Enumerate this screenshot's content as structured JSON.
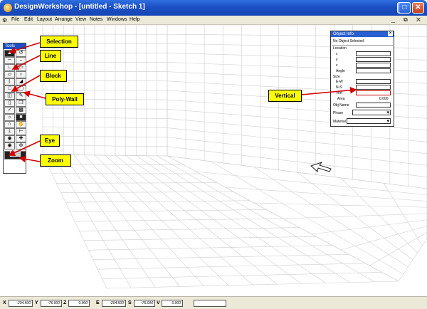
{
  "window": {
    "title": "DesignWorkshop - [untitled - Sketch 1]",
    "minimize": "–",
    "maximize": "□",
    "close": "✕"
  },
  "menubar": {
    "items": [
      "File",
      "Edit",
      "Layout",
      "Arrange",
      "View",
      "Notes",
      "Windows",
      "Help"
    ],
    "mdi_controls": "_ ⧉ ✕"
  },
  "tools_palette": {
    "title": "Tools"
  },
  "object_info": {
    "title": "Object Info",
    "selection": "No Object Selected",
    "location_label": "Location",
    "x_label": "x",
    "y_label": "y",
    "z_label": "z",
    "angle_label": "Angle",
    "size_label": "Size",
    "ew_label": "E-W",
    "ns_label": "N-S",
    "vert_label": "Vert",
    "area_label": "Area",
    "area_value": "0.000",
    "obj_name_label": "Obj Name",
    "phase_label": "Phase",
    "material_label": "Material"
  },
  "callouts": {
    "selection": "Selection",
    "line": "Line",
    "block": "Block",
    "poly_wall": "Poly-Wall",
    "eye": "Eye",
    "zoom": "Zoom",
    "vertical": "Vertical"
  },
  "status_bar": {
    "x_label": "X",
    "x_value": "-204.500",
    "y_label": "Y",
    "y_value": "-76.000",
    "z_label": "Z",
    "z_value": "0.000",
    "e_label": "E",
    "e_value": "-204.500",
    "s_label": "S",
    "s_value": "-76.000",
    "v_label": "V",
    "v_value": "0.000"
  },
  "colors": {
    "titlebar": "#1b4fc4",
    "callout": "#ffff00",
    "arrow": "#d40000",
    "grid": "#c8c8c8"
  }
}
